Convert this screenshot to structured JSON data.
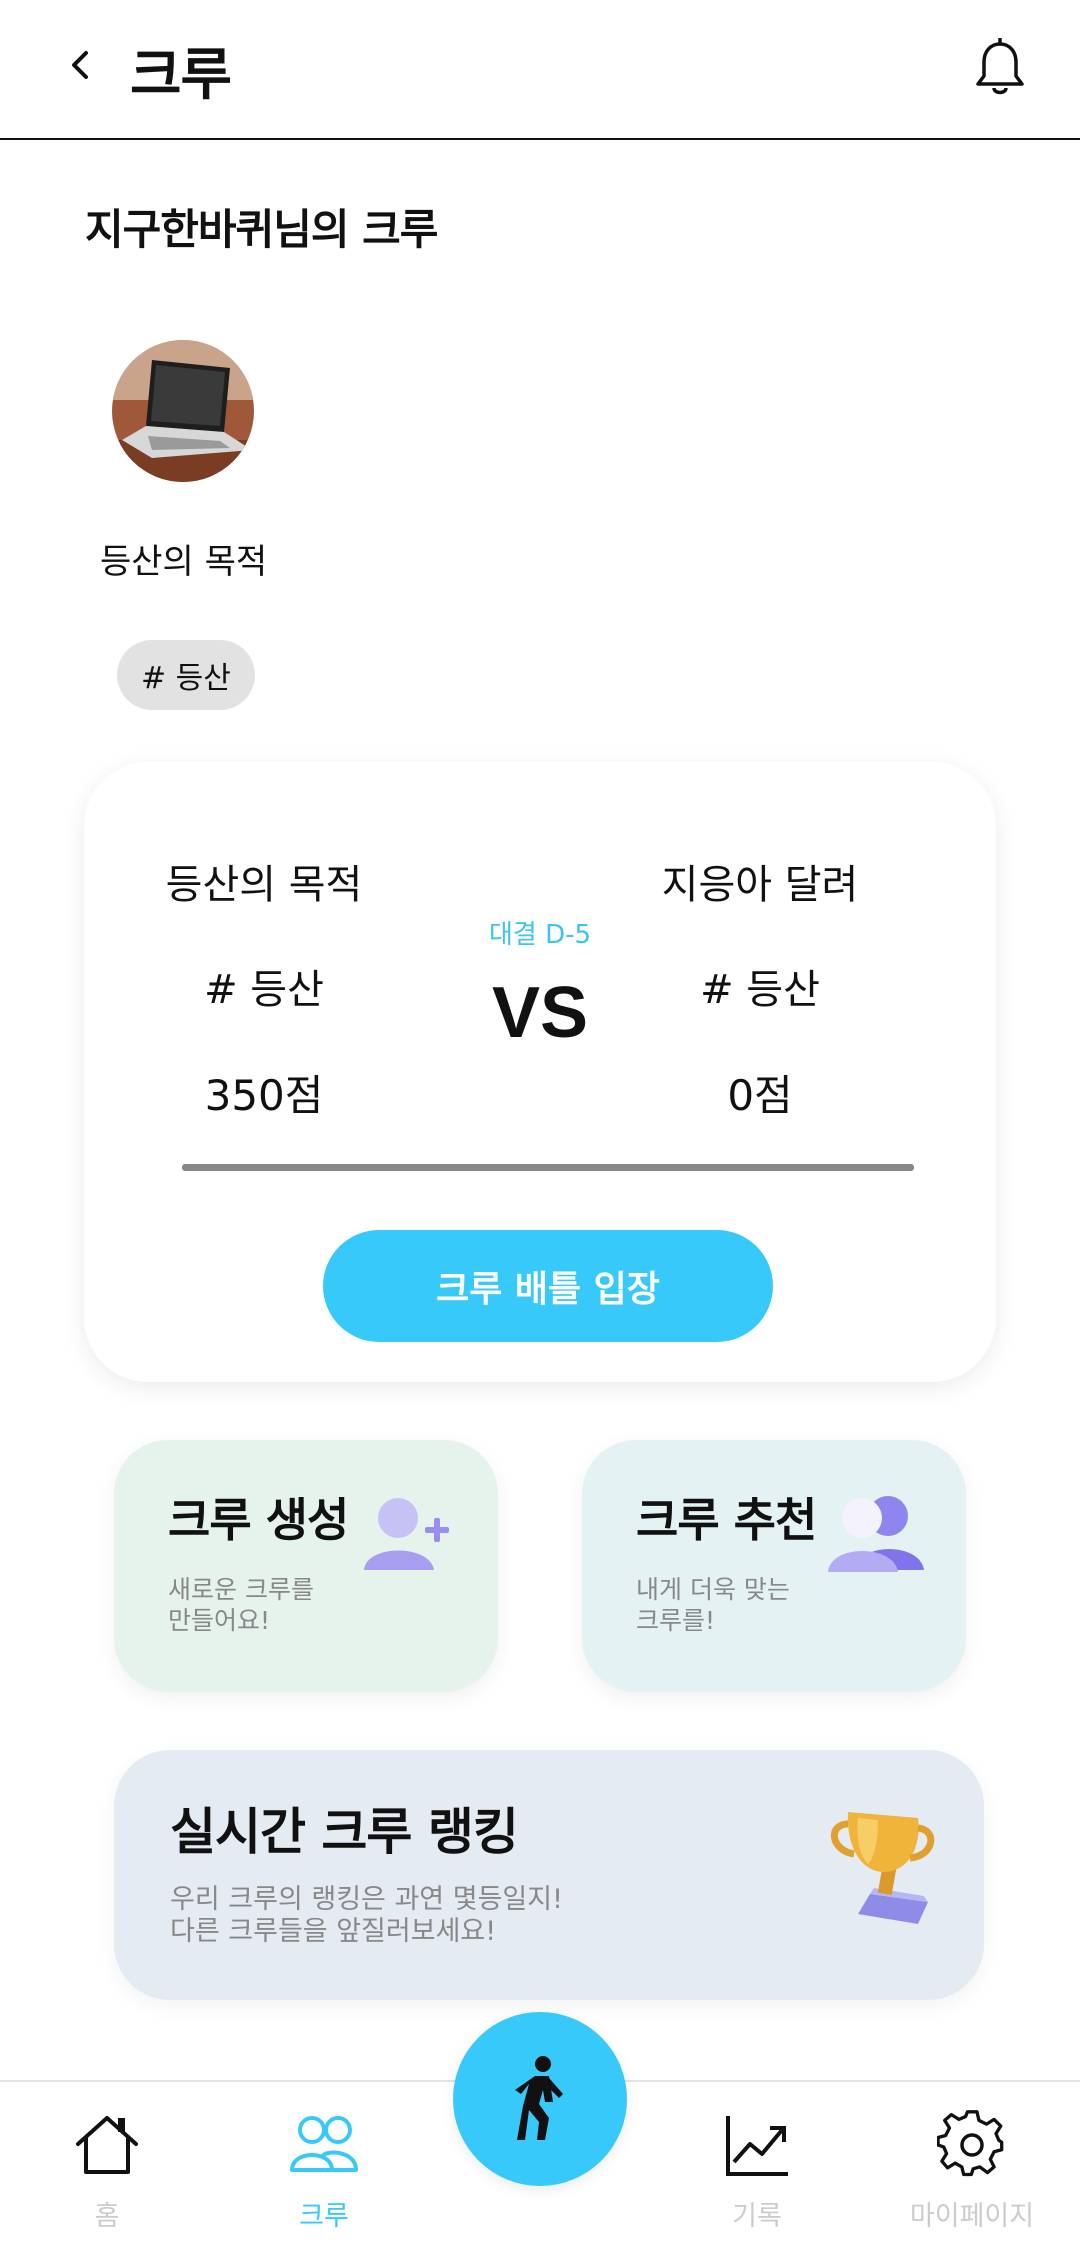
{
  "header": {
    "title": "크루",
    "back_icon": "chevron-left-icon",
    "bell_icon": "bell-icon"
  },
  "crew": {
    "owner_title": "지구한바퀴님의 크루",
    "name": "등산의 목적",
    "tag": "# 등산"
  },
  "battle": {
    "dday": "대결 D-5",
    "vs": "VS",
    "left": {
      "name": "등산의 목적",
      "tag": "# 등산",
      "score": "350점"
    },
    "right": {
      "name": "지응아 달려",
      "tag": "# 등산",
      "score": "0점"
    },
    "enter_label": "크루 배틀 입장",
    "accent": "#38c9fb"
  },
  "cards": {
    "create": {
      "title": "크루 생성",
      "desc": "새로운 크루를\n만들어요!"
    },
    "recommend": {
      "title": "크루 추천",
      "desc": "내게 더욱 맞는\n크루를!"
    },
    "ranking": {
      "title": "실시간 크루 랭킹",
      "desc": "우리 크루의 랭킹은 과연 몇등일지!\n다른 크루들을 앞질러보세요!"
    }
  },
  "nav": {
    "items": [
      {
        "label": "홈",
        "icon": "home-icon"
      },
      {
        "label": "크루",
        "icon": "people-icon",
        "active": true
      },
      {
        "label": "기록",
        "icon": "chart-icon"
      },
      {
        "label": "마이페이지",
        "icon": "gear-icon"
      }
    ],
    "fab_icon": "walking-icon"
  }
}
